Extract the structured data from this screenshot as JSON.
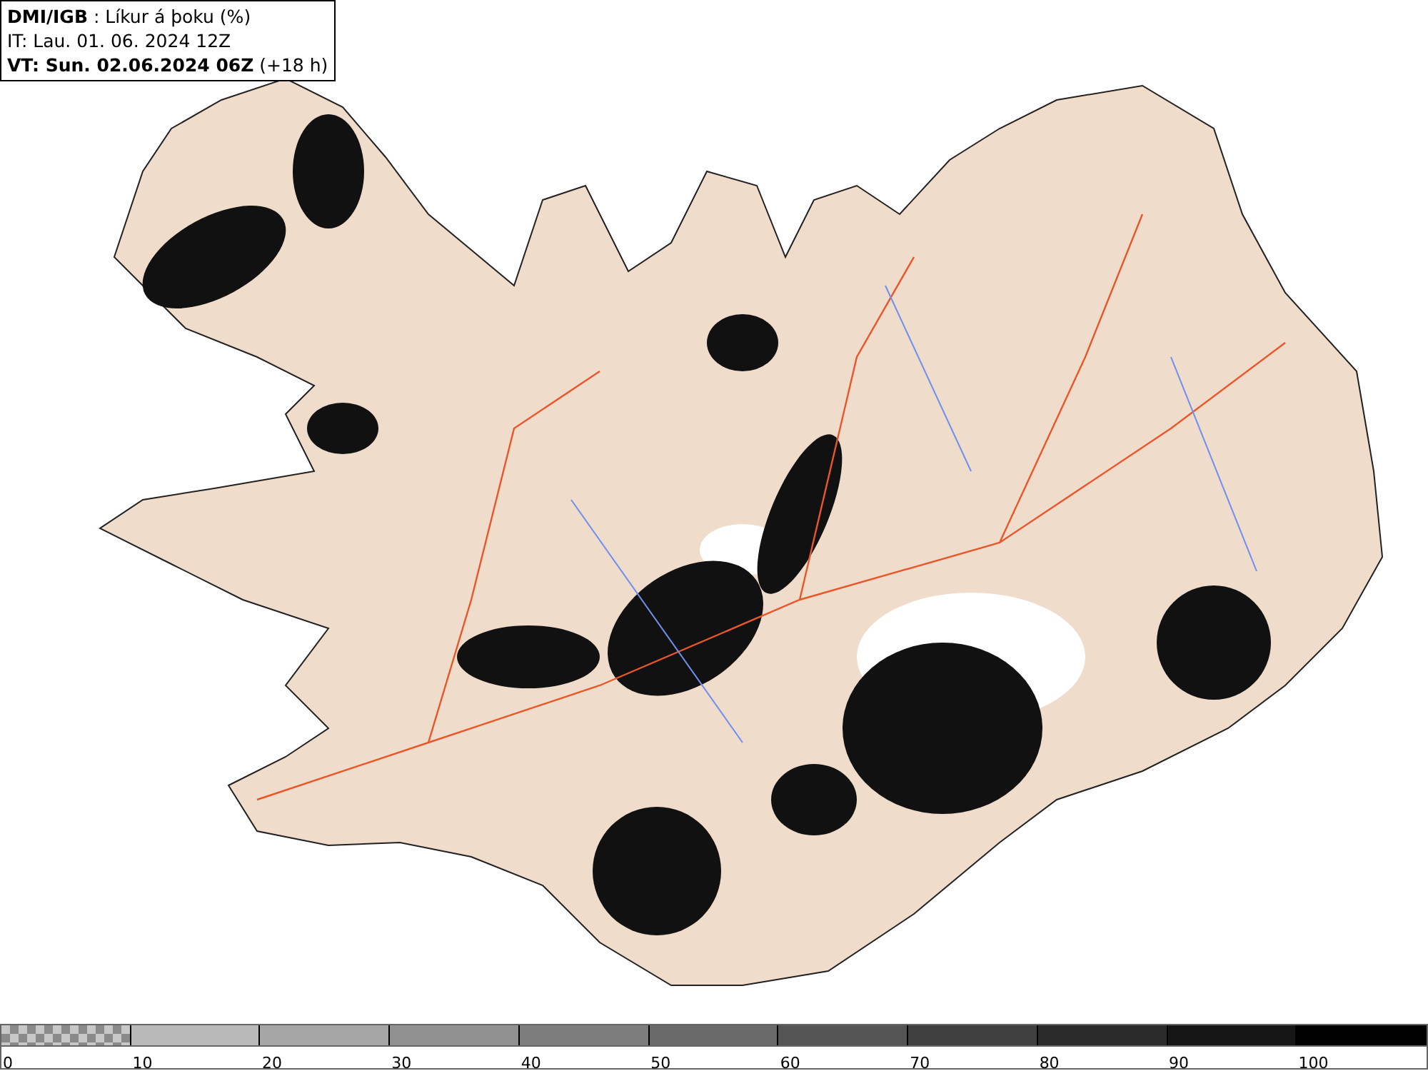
{
  "header": {
    "lines": [
      "**DMI/IGB** : Líkur á þoku (%)",
      "IT: Lau. 01. 06. 2024 12Z",
      "**VT: Sun. 02.06.2024 06Z** (+18 h)"
    ]
  },
  "legend": {
    "segments": [
      {
        "label": "0",
        "kind": "checker",
        "color": "#8a8a8a"
      },
      {
        "label": "10",
        "kind": "solid",
        "color": "#b9b9b9"
      },
      {
        "label": "20",
        "kind": "solid",
        "color": "#a5a5a5"
      },
      {
        "label": "30",
        "kind": "solid",
        "color": "#919191"
      },
      {
        "label": "40",
        "kind": "solid",
        "color": "#7d7d7d"
      },
      {
        "label": "50",
        "kind": "solid",
        "color": "#696969"
      },
      {
        "label": "60",
        "kind": "solid",
        "color": "#555555"
      },
      {
        "label": "70",
        "kind": "solid",
        "color": "#3f3f3f"
      },
      {
        "label": "80",
        "kind": "solid",
        "color": "#2b2b2b"
      },
      {
        "label": "90",
        "kind": "solid",
        "color": "#161616"
      },
      {
        "label": "100",
        "kind": "solid",
        "color": "#000000"
      }
    ]
  }
}
